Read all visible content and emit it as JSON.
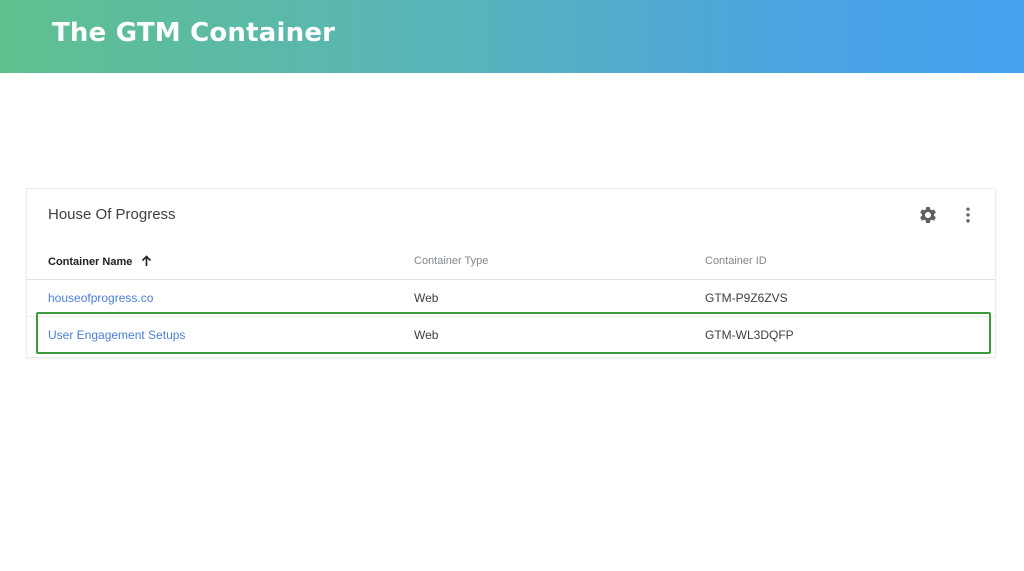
{
  "banner": {
    "title": "The GTM Container"
  },
  "account": {
    "name": "House Of Progress",
    "settings_icon": "gear-icon",
    "more_icon": "more-vert-icon"
  },
  "table": {
    "columns": {
      "name": "Container Name",
      "type": "Container Type",
      "id": "Container ID"
    },
    "sort": {
      "column": "name",
      "direction": "ascending",
      "icon": "arrow-up-icon"
    },
    "rows": [
      {
        "name": "houseofprogress.co",
        "type": "Web",
        "id": "GTM-P9Z6ZVS"
      },
      {
        "name": "User Engagement Setups",
        "type": "Web",
        "id": "GTM-WL3DQFP"
      }
    ]
  },
  "highlight": {
    "row": "User Engagement Setups",
    "color": "#3d9b3d"
  },
  "colors": {
    "banner_start": "#5fc08f",
    "banner_end": "#45a0ee",
    "link": "#4a7fd6"
  }
}
